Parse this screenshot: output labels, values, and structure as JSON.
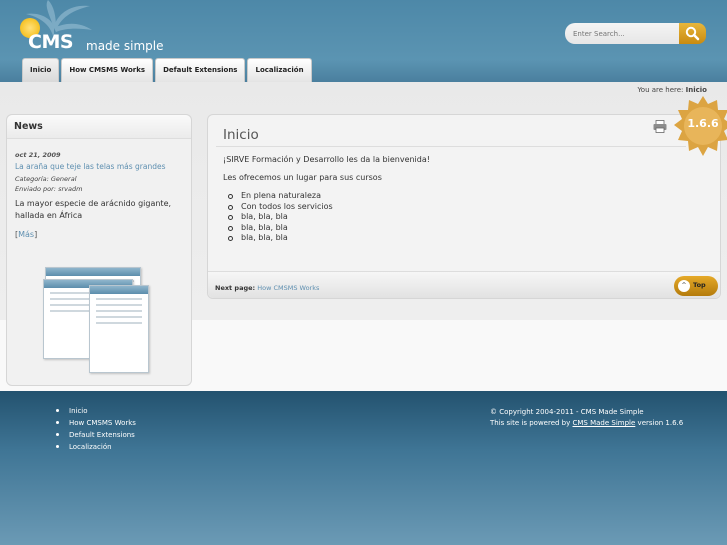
{
  "brand": {
    "logo_text": "CMS",
    "tagline": "made simple"
  },
  "search": {
    "placeholder": "Enter Search..."
  },
  "nav": {
    "tabs": [
      {
        "label": "Inicio"
      },
      {
        "label": "How CMSMS Works"
      },
      {
        "label": "Default Extensions"
      },
      {
        "label": "Localización"
      }
    ]
  },
  "breadcrumb": {
    "prefix": "You are here:",
    "current": "Inicio"
  },
  "version_badge": "1.6.6",
  "sidebar": {
    "heading": "News",
    "item": {
      "date": "oct 21, 2009",
      "title": "La araña que teje las telas más grandes",
      "category": "Categoría: General",
      "author": "Enviado por: srvadm",
      "summary": "La mayor especie de arácnido gigante, hallada en África",
      "more_open": "[",
      "more_label": "Más",
      "more_close": "]"
    }
  },
  "main": {
    "title": "Inicio",
    "paragraph1": "¡SIRVE Formación y Desarrollo les da la bienvenida!",
    "paragraph2": "Les ofrecemos un lugar para sus cursos",
    "bullets": [
      "En plena naturaleza",
      "Con todos los servicios",
      "bla, bla, bla",
      "bla, bla, bla",
      "bla, bla, bla"
    ],
    "next_label": "Next page:",
    "next_link": "How CMSMS Works",
    "top_label": "Top",
    "top_arrow": "^"
  },
  "footer": {
    "links": [
      "Inicio",
      "How CMSMS Works",
      "Default Extensions",
      "Localización"
    ],
    "copyright": "© Copyright 2004-2011 - CMS Made Simple",
    "powered_prefix": "This site is powered by",
    "powered_link": "CMS Made Simple",
    "powered_suffix": "version 1.6.6"
  },
  "colors": {
    "header_blue": "#4d88a8",
    "footer_blue": "#23526f",
    "accent_gold": "#e5a928",
    "link_blue": "#5e8fb0"
  },
  "icons": [
    "palm-logo-icon",
    "search-icon",
    "print-icon",
    "arrow-up-icon"
  ]
}
